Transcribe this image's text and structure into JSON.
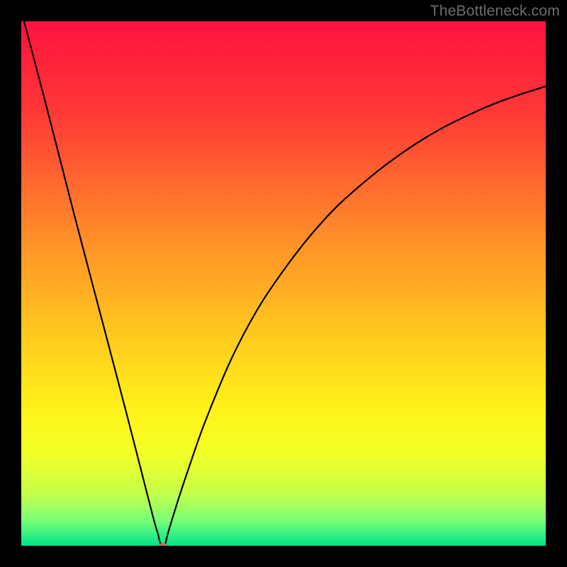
{
  "watermark": "TheBottleneck.com",
  "chart_data": {
    "type": "line",
    "title": "",
    "xlabel": "",
    "ylabel": "",
    "xlim": [
      0,
      100
    ],
    "ylim": [
      0,
      100
    ],
    "gradient_stops": [
      {
        "offset": 0.0,
        "color": "#ff123f"
      },
      {
        "offset": 0.18,
        "color": "#ff3a36"
      },
      {
        "offset": 0.4,
        "color": "#ff8a2a"
      },
      {
        "offset": 0.58,
        "color": "#ffc41f"
      },
      {
        "offset": 0.74,
        "color": "#fff21a"
      },
      {
        "offset": 0.82,
        "color": "#f4ff25"
      },
      {
        "offset": 0.9,
        "color": "#c6ff4a"
      },
      {
        "offset": 0.95,
        "color": "#7cff76"
      },
      {
        "offset": 1.0,
        "color": "#00e38a"
      }
    ],
    "series": [
      {
        "name": "curve",
        "color": "#000000",
        "x": [
          0,
          5,
          10,
          15,
          20,
          25,
          26,
          26.5,
          27,
          27.5,
          28,
          30,
          32,
          35,
          40,
          45,
          50,
          55,
          60,
          65,
          70,
          75,
          80,
          85,
          90,
          95,
          100
        ],
        "y": [
          102,
          83,
          63.5,
          44.5,
          25.5,
          6,
          2.5,
          0.5,
          0,
          0.5,
          2.5,
          9,
          15,
          23.5,
          35.5,
          45,
          52.5,
          59,
          64.5,
          69,
          73,
          76.5,
          79.5,
          82,
          84.2,
          86,
          87.6
        ]
      }
    ],
    "marker": {
      "x": 27,
      "y": 0,
      "color": "#d06a52",
      "rx": 6,
      "ry": 4
    }
  }
}
